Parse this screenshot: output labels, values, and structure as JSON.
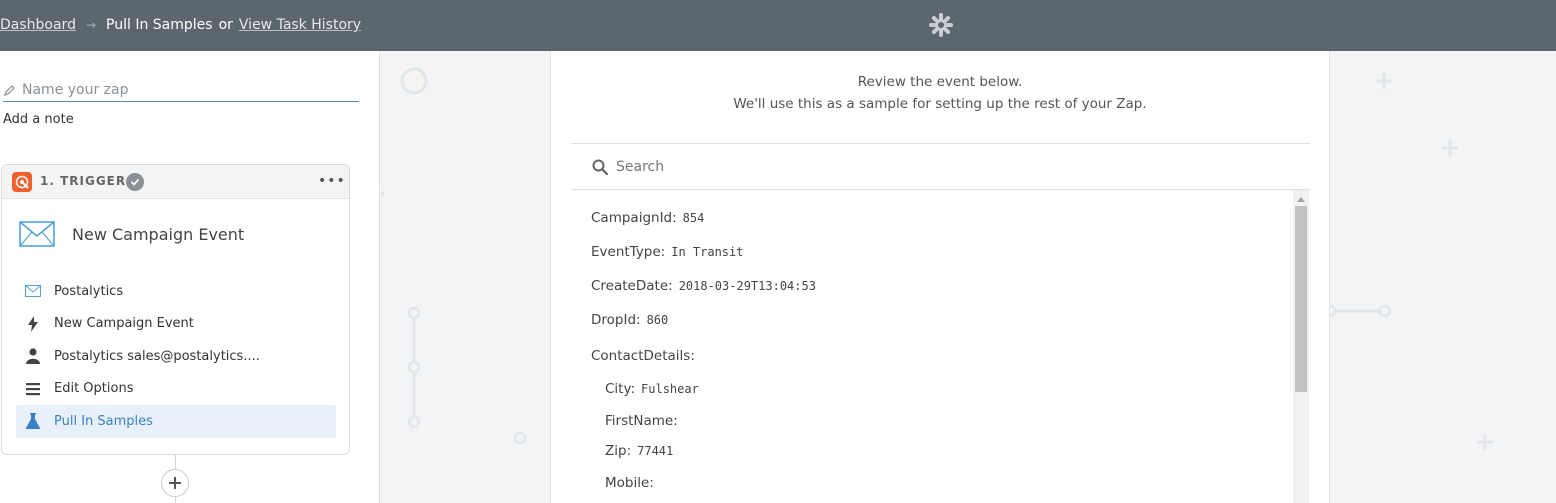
{
  "header": {
    "crumb_dashboard": "Dashboard",
    "crumb_arrow": "→",
    "crumb_current": "Pull In Samples",
    "crumb_or": "or",
    "crumb_history": "View Task History",
    "logo_icon": "zapier-asterisk-icon"
  },
  "sidebar": {
    "zap_name_placeholder": "Name your zap",
    "add_note": "Add a note",
    "trigger": {
      "label": "1. TRIGGER",
      "menu": "•••",
      "event_title": "New Campaign Event",
      "steps": [
        {
          "label": "Postalytics",
          "icon": "envelope-icon"
        },
        {
          "label": "New Campaign Event",
          "icon": "bolt-icon"
        },
        {
          "label": "Postalytics sales@postalytics....",
          "icon": "user-icon"
        },
        {
          "label": "Edit Options",
          "icon": "list-icon"
        },
        {
          "label": "Pull In Samples",
          "icon": "flask-icon",
          "active": true
        }
      ]
    },
    "add_step_icon": "plus-icon"
  },
  "main": {
    "intro_line1": "Review the event below.",
    "intro_line2": "We'll use this as a sample for setting up the rest of your Zap.",
    "search_placeholder": "Search",
    "fields": [
      {
        "key": "CampaignId:",
        "value": "854"
      },
      {
        "key": "EventType:",
        "value": "In Transit"
      },
      {
        "key": "CreateDate:",
        "value": "2018-03-29T13:04:53"
      },
      {
        "key": "DropId:",
        "value": "860"
      },
      {
        "key": "ContactDetails:",
        "value": ""
      },
      {
        "key": "City:",
        "value": "Fulshear"
      },
      {
        "key": "FirstName:",
        "value": ""
      },
      {
        "key": "Zip:",
        "value": "77441"
      },
      {
        "key": "Mobile:",
        "value": ""
      }
    ]
  },
  "colors": {
    "topbar": "#5b666e",
    "trigger_orange": "#f0612e",
    "active_blue": "#3b7fc4",
    "active_bg": "#e8f1fa"
  }
}
